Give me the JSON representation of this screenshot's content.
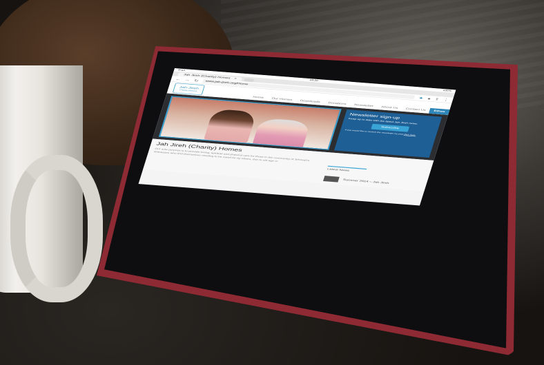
{
  "device": {
    "carrier": "iPad",
    "clock": "09:30",
    "battery": "100%"
  },
  "browser": {
    "tab_title": "Jah Jireh (Charity) Homes",
    "tab_close": "×",
    "url": "www.jah-jireh.org/Home"
  },
  "site": {
    "logo_text": "Jah-Jireh",
    "logo_subtext": "Charity Homes",
    "menu": [
      "Home",
      "Our Homes",
      "Downloads",
      "Donations",
      "Newsletter",
      "About Us",
      "Contact Us",
      "Ethos"
    ],
    "active_menu": "Ethos",
    "newsletter": {
      "title": "Newsletter sign-up",
      "text": "Keep up to date with the latest Jah Jireh news.",
      "button": "Subscribe",
      "small": "If you would like to receive the newsletter by post",
      "link": "click here."
    },
    "page_title": "Jah Jireh (Charity) Homes",
    "page_text": "Our sole purpose is to provide loving, spiritual and physical care for those in the community of Jehovah's Witnesses who find themselves needing to be cared for by others, due to old age or",
    "latest_news": "Latest News",
    "news_item": "Summer 2014 – Jah Jireh"
  },
  "icons": [
    "back-icon",
    "forward-icon",
    "reload-icon",
    "star-icon",
    "mic-icon",
    "share-icon",
    "menu-dots-icon"
  ],
  "colors": {
    "accent": "#2e86b8",
    "newsletter_bg": "#1e5f95",
    "case": "#8e2a33"
  }
}
